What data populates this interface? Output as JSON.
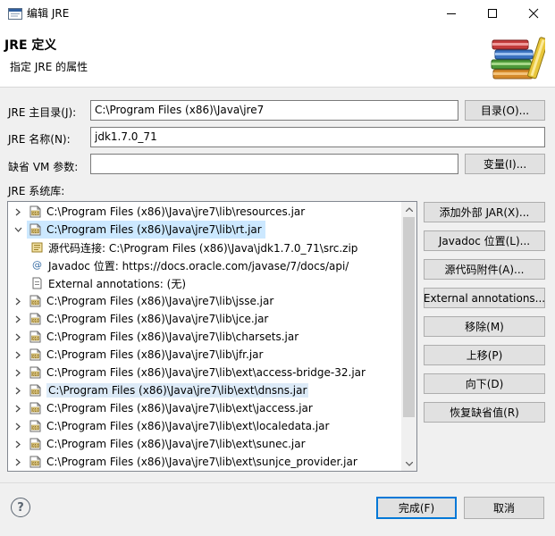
{
  "window": {
    "title": "编辑 JRE",
    "minimize_glyph": "—",
    "maximize_glyph": "☐",
    "close_glyph": "✕"
  },
  "banner": {
    "title": "JRE 定义",
    "subtitle": "指定 JRE 的属性",
    "icon": "books-icon"
  },
  "form": {
    "home_label": "JRE 主目录(J):",
    "home_value": "C:\\Program Files (x86)\\Java\\jre7",
    "directory_button": "目录(O)...",
    "name_label": "JRE 名称(N):",
    "name_value": "jdk1.7.0_71",
    "vmargs_label": "缺省 VM 参数:",
    "vmargs_value": "",
    "variables_button": "变量(I)...",
    "libraries_label": "JRE 系统库:"
  },
  "tree": {
    "rows": [
      {
        "kind": "jar",
        "expand": "collapsed",
        "text": "C:\\Program Files (x86)\\Java\\jre7\\lib\\resources.jar"
      },
      {
        "kind": "jar",
        "expand": "expanded",
        "text": "C:\\Program Files (x86)\\Java\\jre7\\lib\\rt.jar",
        "selected": true
      },
      {
        "kind": "source",
        "expand": "none",
        "text": "源代码连接:  C:\\Program Files (x86)\\Java\\jdk1.7.0_71\\src.zip"
      },
      {
        "kind": "javadoc",
        "expand": "none",
        "text": "Javadoc 位置:  https://docs.oracle.com/javase/7/docs/api/"
      },
      {
        "kind": "annotation",
        "expand": "none",
        "text": "External annotations:  (无)"
      },
      {
        "kind": "jar",
        "expand": "collapsed",
        "text": "C:\\Program Files (x86)\\Java\\jre7\\lib\\jsse.jar"
      },
      {
        "kind": "jar",
        "expand": "collapsed",
        "text": "C:\\Program Files (x86)\\Java\\jre7\\lib\\jce.jar"
      },
      {
        "kind": "jar",
        "expand": "collapsed",
        "text": "C:\\Program Files (x86)\\Java\\jre7\\lib\\charsets.jar"
      },
      {
        "kind": "jar",
        "expand": "collapsed",
        "text": "C:\\Program Files (x86)\\Java\\jre7\\lib\\jfr.jar"
      },
      {
        "kind": "jar",
        "expand": "collapsed",
        "text": "C:\\Program Files (x86)\\Java\\jre7\\lib\\ext\\access-bridge-32.jar"
      },
      {
        "kind": "jar",
        "expand": "collapsed",
        "text": "C:\\Program Files (x86)\\Java\\jre7\\lib\\ext\\dnsns.jar",
        "highlight": true
      },
      {
        "kind": "jar",
        "expand": "collapsed",
        "text": "C:\\Program Files (x86)\\Java\\jre7\\lib\\ext\\jaccess.jar"
      },
      {
        "kind": "jar",
        "expand": "collapsed",
        "text": "C:\\Program Files (x86)\\Java\\jre7\\lib\\ext\\localedata.jar"
      },
      {
        "kind": "jar",
        "expand": "collapsed",
        "text": "C:\\Program Files (x86)\\Java\\jre7\\lib\\ext\\sunec.jar"
      },
      {
        "kind": "jar",
        "expand": "collapsed",
        "text": "C:\\Program Files (x86)\\Java\\jre7\\lib\\ext\\sunjce_provider.jar"
      }
    ]
  },
  "side_buttons": {
    "add_external_jar": "添加外部 JAR(X)...",
    "javadoc_location": "Javadoc 位置(L)...",
    "source_attachment": "源代码附件(A)...",
    "external_annotations": "External annotations...",
    "remove": "移除(M)",
    "up": "上移(P)",
    "down": "向下(D)",
    "restore_default": "恢复缺省值(R)"
  },
  "footer": {
    "help_glyph": "?",
    "finish_button": "完成(F)",
    "cancel_button": "取消"
  },
  "colors": {
    "selection": "#cce8ff",
    "highlight": "#dceaf7",
    "focus_border": "#0078d7"
  }
}
